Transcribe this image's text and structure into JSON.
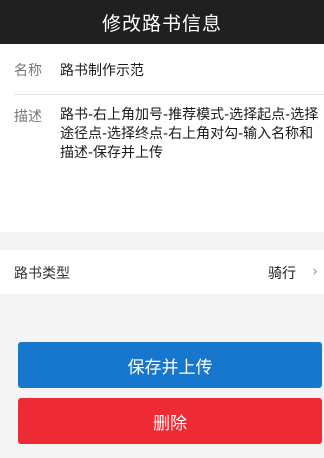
{
  "header": {
    "title": "修改路书信息"
  },
  "form": {
    "name_label": "名称",
    "name_value": "路书制作示范",
    "desc_label": "描述",
    "desc_value": "路书-右上角加号-推荐模式-选择起点-选择途径点-选择终点-右上角对勾-输入名称和描述-保存并上传"
  },
  "type_row": {
    "label": "路书类型",
    "value": "骑行",
    "chevron_icon": "chevron-right-icon"
  },
  "buttons": {
    "save_label": "保存并上传",
    "delete_label": "删除"
  },
  "colors": {
    "titlebar": "#202020",
    "save": "#1677cc",
    "delete": "#ee2b35"
  }
}
